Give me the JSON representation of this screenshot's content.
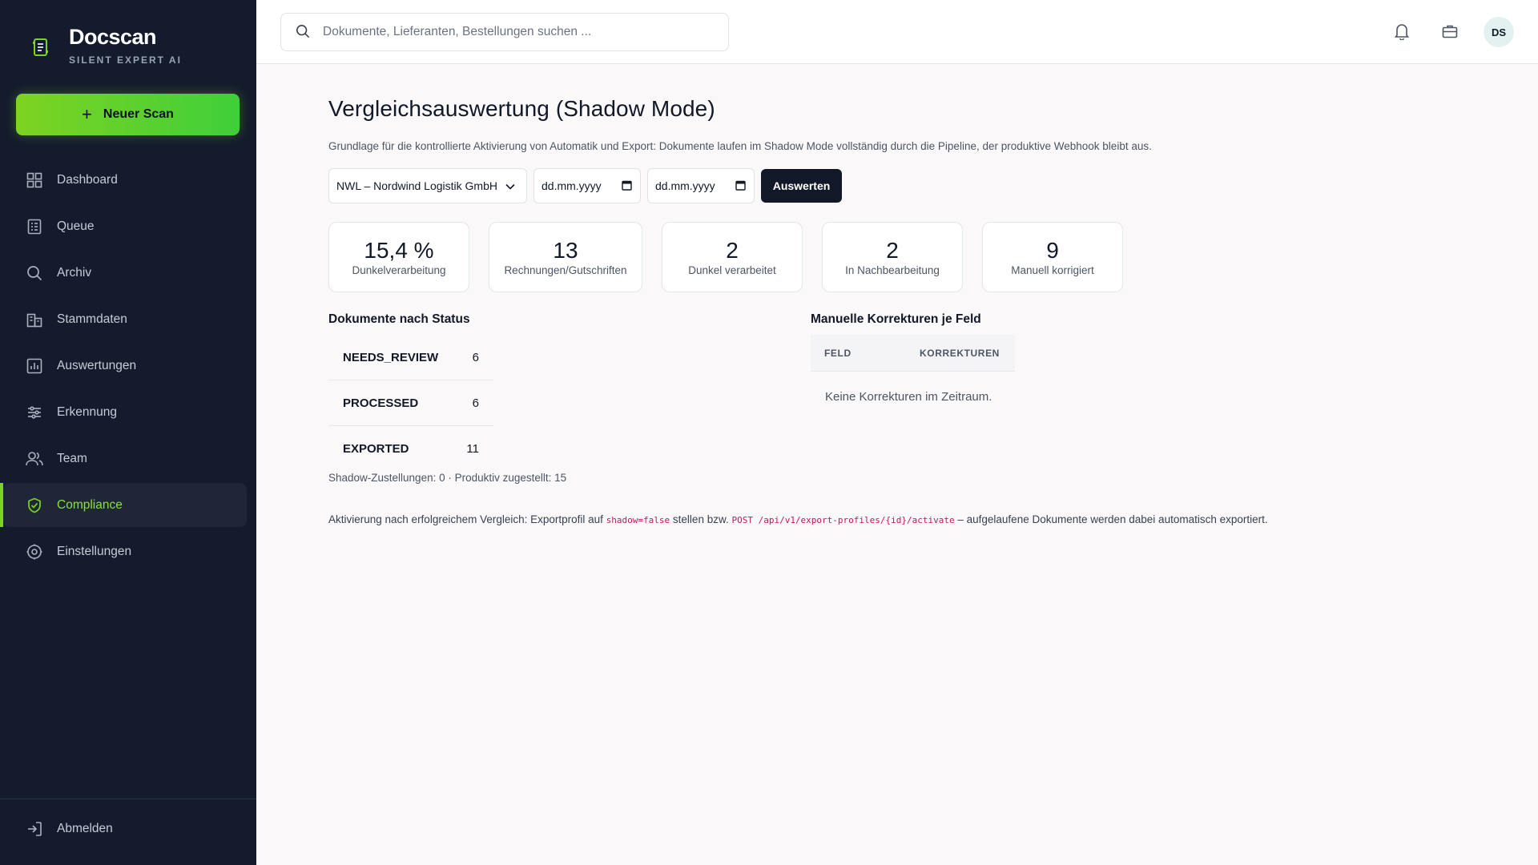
{
  "brand": {
    "name": "Docscan",
    "tagline": "SILENT EXPERT AI"
  },
  "sidebar": {
    "new_scan_label": "Neuer Scan",
    "items": [
      {
        "label": "Dashboard",
        "icon": "dashboard-icon"
      },
      {
        "label": "Queue",
        "icon": "queue-icon"
      },
      {
        "label": "Archiv",
        "icon": "search-icon"
      },
      {
        "label": "Stammdaten",
        "icon": "building-icon"
      },
      {
        "label": "Auswertungen",
        "icon": "chart-icon"
      },
      {
        "label": "Erkennung",
        "icon": "sliders-icon"
      },
      {
        "label": "Team",
        "icon": "users-icon"
      },
      {
        "label": "Compliance",
        "icon": "shield-icon",
        "active": true
      },
      {
        "label": "Einstellungen",
        "icon": "gear-icon"
      }
    ],
    "logout_label": "Abmelden",
    "active_color": "#7ed321"
  },
  "topbar": {
    "search_placeholder": "Dokumente, Lieferanten, Bestellungen suchen ...",
    "avatar_initials": "DS"
  },
  "main": {
    "title": "Vergleichsauswertung (Shadow Mode)",
    "subtitle": "Grundlage für die kontrollierte Aktivierung von Automatik und Export: Dokumente laufen im Shadow Mode vollständig durch die Pipeline, der produktive Webhook bleibt aus.",
    "filters": {
      "supplier_selected": "NWL – Nordwind Logistik GmbH",
      "date_from_placeholder": "dd.mm.yyyy",
      "date_to_placeholder": "dd.mm.yyyy",
      "submit_label": "Auswerten"
    },
    "kpis": [
      {
        "value": "15,4 %",
        "label": "Dunkelverarbeitung"
      },
      {
        "value": "13",
        "label": "Rechnungen/Gutschriften"
      },
      {
        "value": "2",
        "label": "Dunkel verarbeitet"
      },
      {
        "value": "2",
        "label": "In Nachbearbeitung"
      },
      {
        "value": "9",
        "label": "Manuell korrigiert"
      }
    ],
    "status_section": {
      "title": "Dokumente nach Status",
      "rows": [
        {
          "status": "NEEDS_REVIEW",
          "count": "6"
        },
        {
          "status": "PROCESSED",
          "count": "6"
        },
        {
          "status": "EXPORTED",
          "count": "11"
        }
      ],
      "shadow_info": "Shadow-Zustellungen: 0 · Produktiv zugestellt: 15"
    },
    "corrections_section": {
      "title": "Manuelle Korrekturen je Feld",
      "columns": [
        "FELD",
        "KORREKTUREN"
      ],
      "empty_text": "Keine Korrekturen im Zeitraum."
    },
    "activation_note": {
      "before": "Aktivierung nach erfolgreichem Vergleich: Exportprofil auf ",
      "code1": "shadow=false",
      "middle": " stellen bzw. ",
      "code2": "POST /api/v1/export-profiles/{id}/activate",
      "after": " – aufgelaufene Dokumente werden dabei automatisch exportiert."
    }
  }
}
